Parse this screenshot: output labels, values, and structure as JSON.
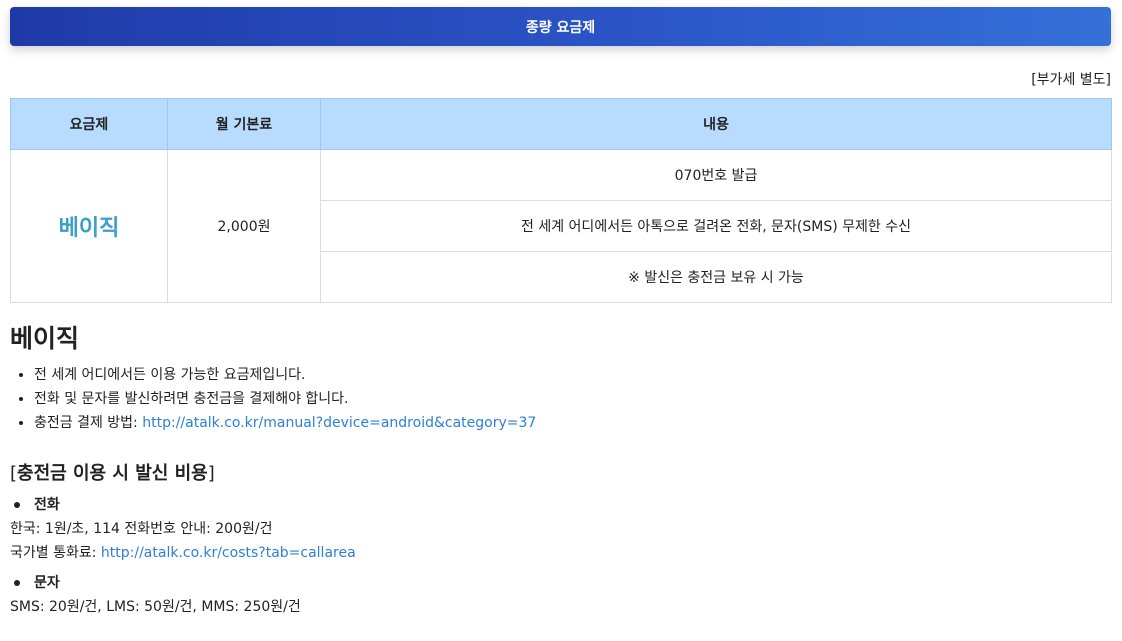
{
  "banner": {
    "title": "종량 요금제"
  },
  "vat_note": "[부가세 별도]",
  "table": {
    "headers": [
      "요금제",
      "월 기본료",
      "내용"
    ],
    "plan_name": "베이직",
    "monthly_fee": "2,000원",
    "contents": [
      "070번호 발급",
      "전 세계 어디에서든 아톡으로 걸려온 전화, 문자(SMS) 무제한 수신",
      "※ 발신은 충전금 보유 시 가능"
    ]
  },
  "section": {
    "title": "베이직",
    "bullets": [
      "전 세계 어디에서든 이용 가능한 요금제입니다.",
      "전화 및 문자를 발신하려면 충전금을 결제해야 합니다."
    ],
    "payment_label": "충전금 결제 방법: ",
    "payment_link": "http://atalk.co.kr/manual?device=android&category=37"
  },
  "costs": {
    "open_bracket": "[",
    "title": "충전금 이용 시 발신 비용",
    "close_bracket": "]",
    "call": {
      "label": "전화",
      "line1": "한국: 1원/초, 114 전화번호 안내: 200원/건",
      "line2_label": "국가별 통화료: ",
      "line2_link": "http://atalk.co.kr/costs?tab=callarea"
    },
    "sms": {
      "label": "문자",
      "line1": "SMS: 20원/건, LMS: 50원/건, MMS: 250원/건"
    }
  }
}
